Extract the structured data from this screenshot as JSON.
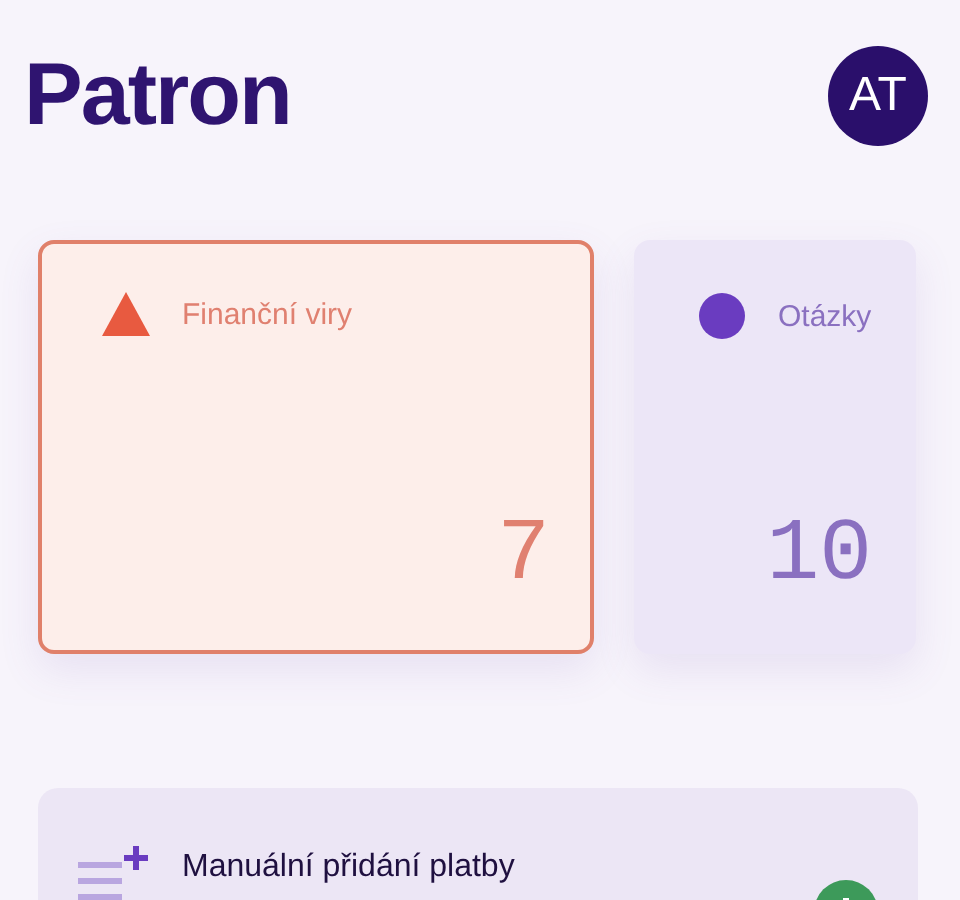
{
  "header": {
    "title": "Patron",
    "avatar": "AT"
  },
  "cards": [
    {
      "kind": "warning",
      "label": "Finanční viry",
      "count": "7",
      "selected": true
    },
    {
      "kind": "question",
      "label": "Otázky",
      "count": "10",
      "selected": false
    }
  ],
  "action": {
    "label": "Manuální přidání platby"
  }
}
